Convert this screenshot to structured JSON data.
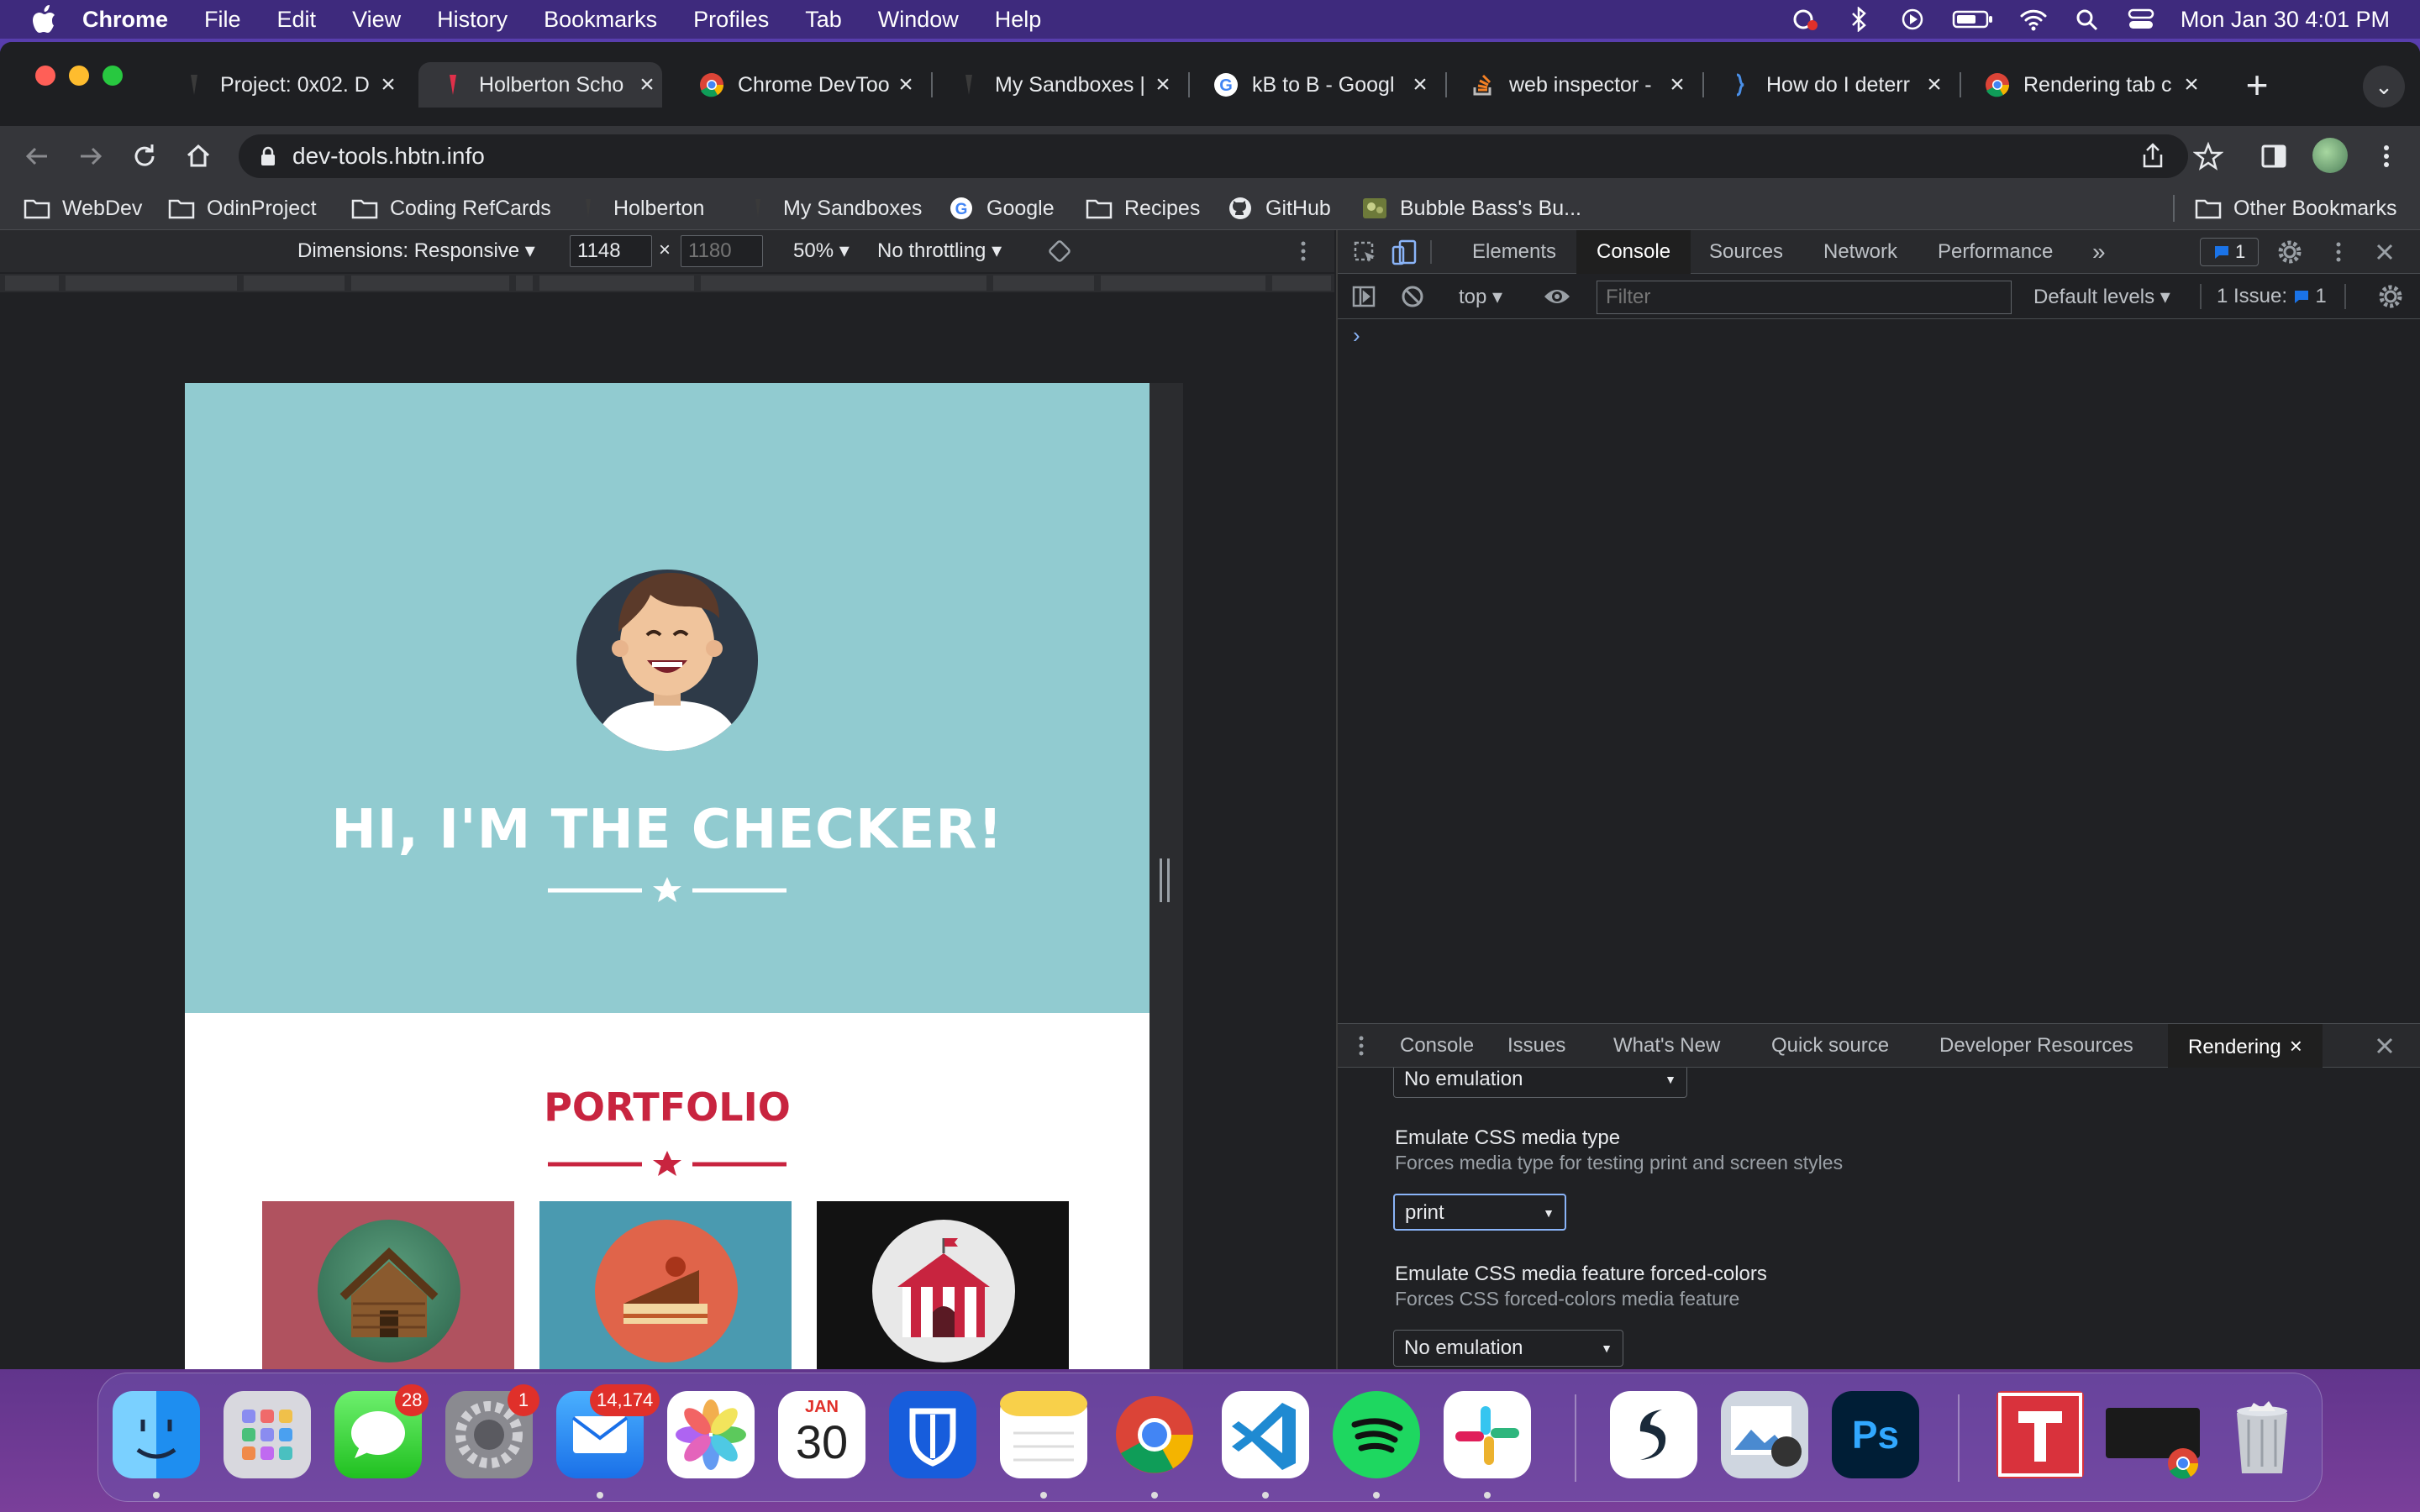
{
  "menubar": {
    "app": "Chrome",
    "items": [
      "File",
      "Edit",
      "View",
      "History",
      "Bookmarks",
      "Profiles",
      "Tab",
      "Window",
      "Help"
    ],
    "clock": "Mon Jan 30  4:01 PM"
  },
  "tabs": [
    {
      "title": "Project: 0x02. D",
      "icon": "holberton-icon"
    },
    {
      "title": "Holberton Scho",
      "icon": "holberton-icon"
    },
    {
      "title": "Chrome DevToo",
      "icon": "chrome-icon"
    },
    {
      "title": "My Sandboxes |",
      "icon": "holberton-icon"
    },
    {
      "title": "kB to B - Googl",
      "icon": "google-icon"
    },
    {
      "title": "web inspector -",
      "icon": "stackoverflow-icon"
    },
    {
      "title": "How do I deterr",
      "icon": "bracket-icon"
    },
    {
      "title": "Rendering tab c",
      "icon": "chrome-icon"
    }
  ],
  "address": {
    "url": "dev-tools.hbtn.info"
  },
  "bookmarks": [
    {
      "label": "WebDev",
      "icon": "folder-icon"
    },
    {
      "label": "OdinProject",
      "icon": "folder-icon"
    },
    {
      "label": "Coding RefCards",
      "icon": "folder-icon"
    },
    {
      "label": "Holberton",
      "icon": "holberton-icon"
    },
    {
      "label": "My Sandboxes",
      "icon": "holberton-icon"
    },
    {
      "label": "Google",
      "icon": "google-icon"
    },
    {
      "label": "Recipes",
      "icon": "folder-icon"
    },
    {
      "label": "GitHub",
      "icon": "github-icon"
    },
    {
      "label": "Bubble Bass's Bu...",
      "icon": "bubble-icon"
    }
  ],
  "other_bookmarks": "Other Bookmarks",
  "device_toolbar": {
    "dimensions": "Dimensions: Responsive",
    "width": "1148",
    "x": "×",
    "height_placeholder": "1180",
    "zoom": "50%",
    "throttling": "No throttling"
  },
  "site": {
    "heading": "HI, I'M THE CHECKER!",
    "portfolio": "PORTFOLIO"
  },
  "devtools": {
    "tabs": [
      "Elements",
      "Console",
      "Sources",
      "Network",
      "Performance"
    ],
    "active_tab": "Console",
    "issues_count": "1",
    "context": "top",
    "filter_placeholder": "Filter",
    "levels": "Default levels",
    "issue_label": "1 Issue:",
    "issue_count": "1",
    "prompt": "›"
  },
  "drawer": {
    "tabs": [
      "Console",
      "Issues",
      "What's New",
      "Quick source",
      "Developer Resources"
    ],
    "active_tab": "Rendering",
    "first_select": "No emulation",
    "media_type_label": "Emulate CSS media type",
    "media_type_desc": "Forces media type for testing print and screen styles",
    "media_type_value": "print",
    "forced_colors_label": "Emulate CSS media feature forced-colors",
    "forced_colors_desc": "Forces CSS forced-colors media feature",
    "forced_colors_value": "No emulation"
  },
  "dock": {
    "badges": {
      "messages": "28",
      "settings": "1",
      "mail": "14,174"
    },
    "calendar_month": "JAN",
    "calendar_day": "30"
  },
  "colors": {
    "hero": "#91cbd0",
    "accent": "#c8243f",
    "devtools_bg": "#202124"
  }
}
